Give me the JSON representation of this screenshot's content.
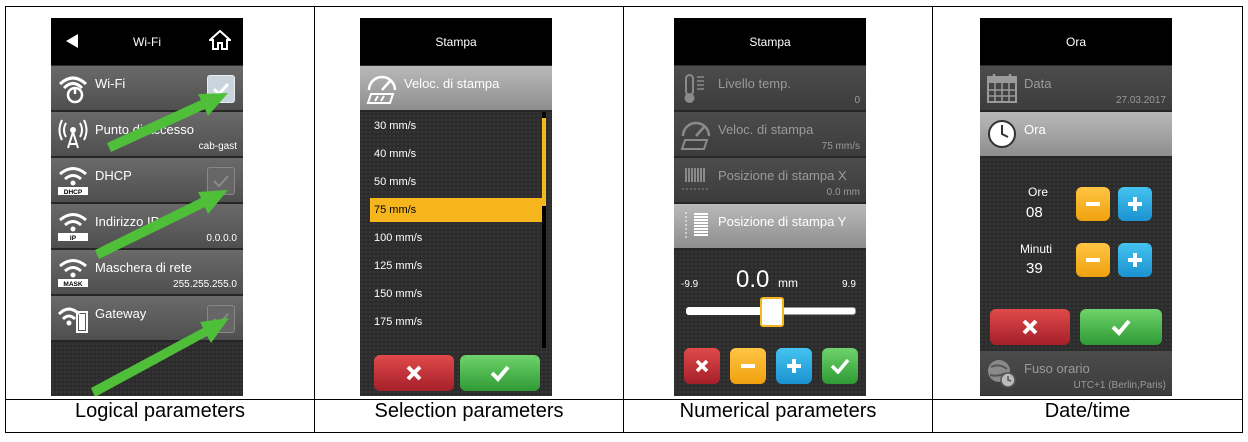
{
  "captions": [
    "Logical parameters",
    "Selection parameters",
    "Numerical parameters",
    "Date/time"
  ],
  "wifi": {
    "title": "Wi-Fi",
    "items": [
      {
        "label": "Wi-Fi",
        "value": "",
        "check": "on"
      },
      {
        "label": "Punto di accesso",
        "value": "cab-gast",
        "check": ""
      },
      {
        "label": "DHCP",
        "value": "",
        "check": "off"
      },
      {
        "label": "Indirizzo IP",
        "value": "0.0.0.0",
        "check": ""
      },
      {
        "label": "Maschera di rete",
        "value": "255.255.255.0",
        "check": ""
      },
      {
        "label": "Gateway",
        "value": "",
        "check": "off"
      }
    ],
    "icon_subs": {
      "dhcp": "DHCP",
      "ip": "IP",
      "mask": "MASK"
    }
  },
  "stampa_sel": {
    "title": "Stampa",
    "header": "Veloc. di stampa",
    "options": [
      "30 mm/s",
      "40 mm/s",
      "50 mm/s",
      "75 mm/s",
      "100 mm/s",
      "125 mm/s",
      "150 mm/s",
      "175 mm/s"
    ],
    "selected_index": 3
  },
  "stampa_num": {
    "title": "Stampa",
    "items": [
      {
        "label": "Livello temp.",
        "value": "0"
      },
      {
        "label": "Veloc. di stampa",
        "value": "75 mm/s"
      },
      {
        "label": "Posizione di stampa X",
        "value": "0.0 mm"
      },
      {
        "label": "Posizione di stampa Y",
        "value": ""
      }
    ],
    "min": "-9.9",
    "max": "9.9",
    "current": "0.0",
    "unit": "mm",
    "slider_fraction": 0.5
  },
  "ora": {
    "title": "Ora",
    "data_label": "Data",
    "date_value": "27.03.2017",
    "ora_label": "Ora",
    "hours_label": "Ore",
    "hours_value": "08",
    "minutes_label": "Minuti",
    "minutes_value": "39",
    "tz_label": "Fuso orario",
    "tz_value": "UTC+1 (Berlin,Paris)"
  },
  "colors": {
    "accent_orange": "#f6b51c",
    "arrow_green": "#4fbf3a",
    "cancel_red": "#c62f36",
    "ok_green": "#43b544",
    "plus_blue": "#27a8e0"
  }
}
